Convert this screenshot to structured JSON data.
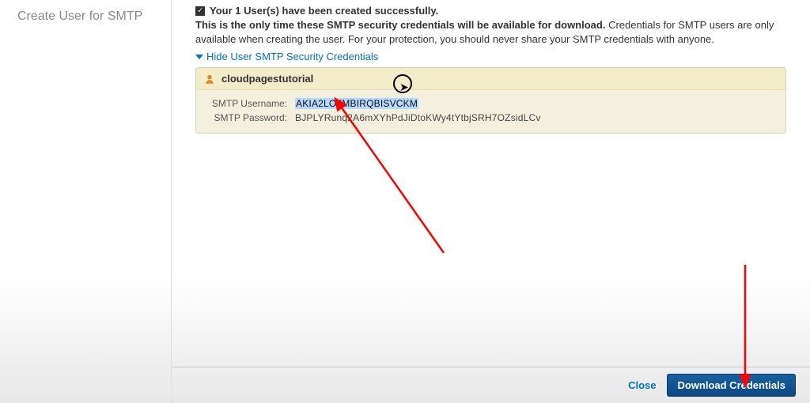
{
  "sidebar": {
    "title": "Create User for SMTP"
  },
  "message": {
    "success": "Your 1 User(s) have been created successfully.",
    "note_bold": "This is the only time these SMTP security credentials will be available for download.",
    "note_rest": " Credentials for SMTP users are only available when creating the user. For your protection, you should never share your SMTP credentials with anyone."
  },
  "toggle": {
    "label": "Hide User SMTP Security Credentials"
  },
  "cred": {
    "user_display": "cloudpagestutorial",
    "username_label": "SMTP Username:",
    "username_value": "AKIA2LO7MBIRQBISVCKM",
    "password_label": "SMTP Password:",
    "password_value": "BJPLYRunq2A6mXYhPdJiDtoKWy4tYtbjSRH7OZsidLCv"
  },
  "footer": {
    "close": "Close",
    "download": "Download Credentials"
  },
  "colors": {
    "link": "#0073bb",
    "cred_bg_header": "#f2ecc9",
    "cred_bg_body": "#f4f0de",
    "btn_primary": "#0d4f8b",
    "selection_bg": "#b6d7ff",
    "arrow": "#ff0000"
  }
}
